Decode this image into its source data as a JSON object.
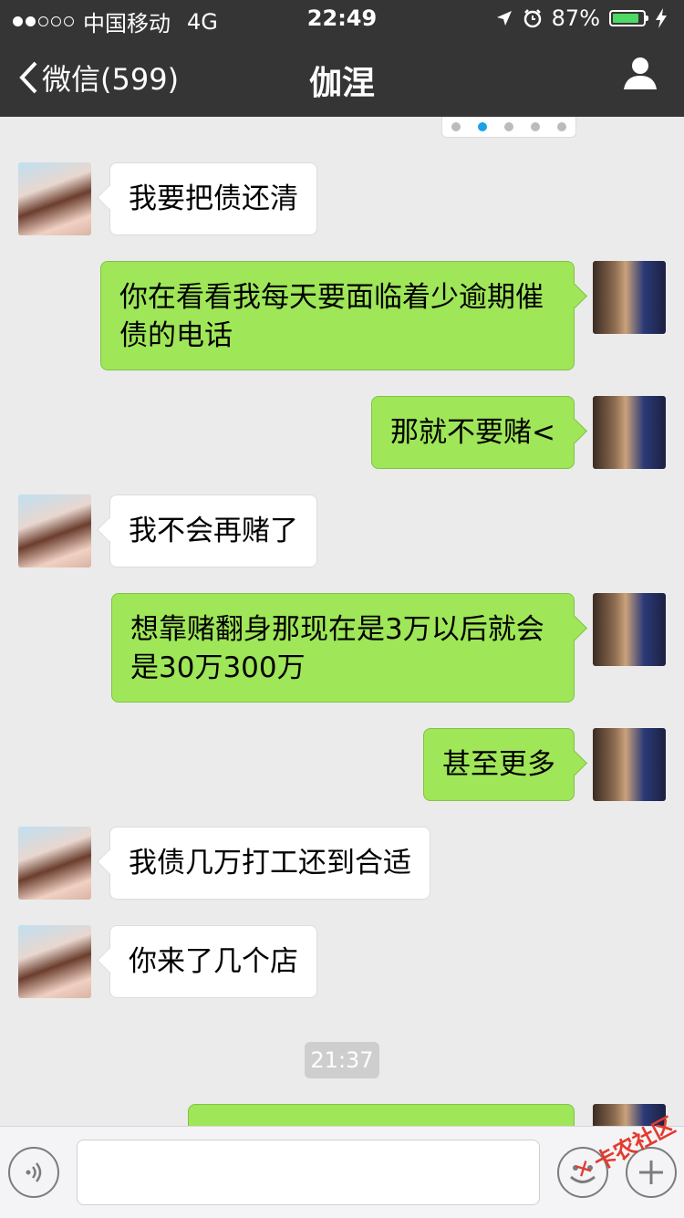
{
  "status_bar": {
    "carrier": "中国移动",
    "network": "4G",
    "time": "22:49",
    "battery": "87%",
    "battery_level": 0.87,
    "signal_bars_filled": 2,
    "signal_bars_total": 5
  },
  "nav": {
    "back_label": "微信(599)",
    "title": "伽涅"
  },
  "messages": [
    {
      "side": "left",
      "text": "我要把债还清"
    },
    {
      "side": "right",
      "text": "你在看看我每天要面临着少逾期催债的电话"
    },
    {
      "side": "right",
      "text": "那就不要赌<"
    },
    {
      "side": "left",
      "text": "我不会再赌了"
    },
    {
      "side": "right",
      "text": "想靠赌翻身那现在是3万以后就会是30万300万"
    },
    {
      "side": "right",
      "text": "甚至更多"
    },
    {
      "side": "left",
      "text": "我债几万打工还到合适"
    },
    {
      "side": "left",
      "text": "你来了几个店"
    }
  ],
  "timestamp": "21:37",
  "watermark": "卡农社区",
  "colors": {
    "header_bg": "#353535",
    "chat_bg": "#ebebeb",
    "sent_bubble": "#9fe658",
    "received_bubble": "#ffffff",
    "battery_fill": "#4cd964"
  },
  "icons": {
    "back": "chevron-left-icon",
    "profile": "person-icon",
    "voice": "voice-icon",
    "emoji": "emoji-icon",
    "plus": "plus-icon",
    "location": "location-arrow-icon",
    "alarm": "alarm-icon",
    "charging": "charging-bolt-icon"
  }
}
